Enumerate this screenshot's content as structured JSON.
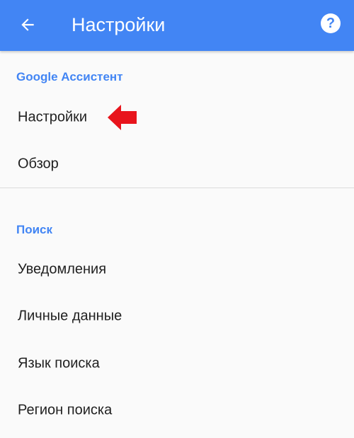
{
  "app_bar": {
    "title": "Настройки",
    "back_icon": "arrow-back-icon",
    "help_icon": "help-icon",
    "help_glyph": "?",
    "background_color": "#4285f4"
  },
  "sections": [
    {
      "header": "Google Ассистент",
      "items": [
        {
          "label": "Настройки"
        },
        {
          "label": "Обзор"
        }
      ]
    },
    {
      "header": "Поиск",
      "items": [
        {
          "label": "Уведомления"
        },
        {
          "label": "Личные данные"
        },
        {
          "label": "Язык поиска"
        },
        {
          "label": "Регион поиска"
        }
      ]
    }
  ],
  "annotation": {
    "icon": "red-arrow-icon",
    "color": "#e8141c"
  },
  "colors": {
    "accent": "#4285f4",
    "text": "#212121",
    "background": "#fafafa"
  }
}
